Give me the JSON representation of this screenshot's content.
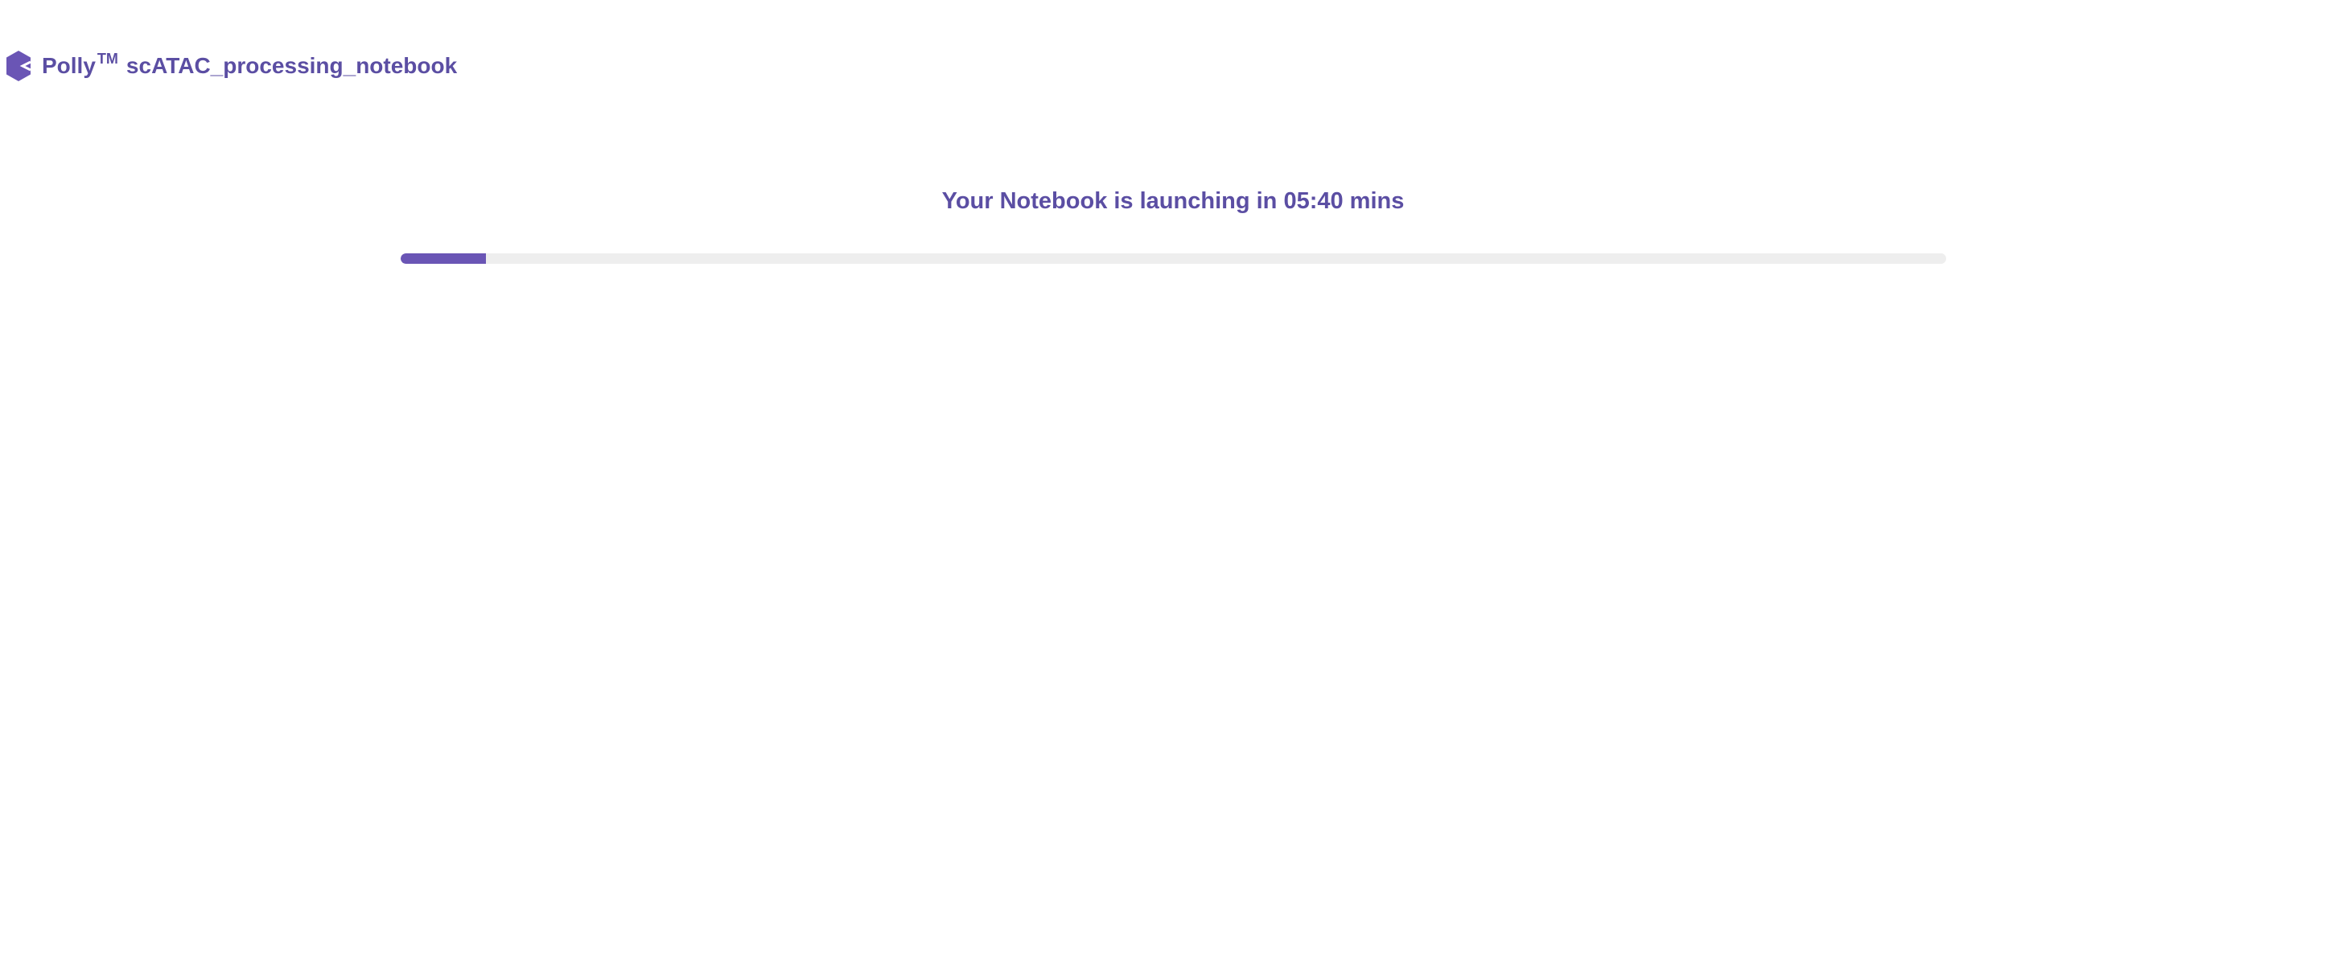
{
  "header": {
    "brand": "Polly",
    "trademark": "TM",
    "notebook_name": "scATAC_processing_notebook",
    "logo_icon": "polly-hexagon-logo-icon"
  },
  "launch": {
    "message": "Your Notebook is launching in 05:40 mins",
    "progress_fraction": 0.055
  },
  "colors": {
    "brand_text": "#5b4ea3",
    "progress_fill": "#6a55b5",
    "progress_track": "#eeeeee"
  }
}
